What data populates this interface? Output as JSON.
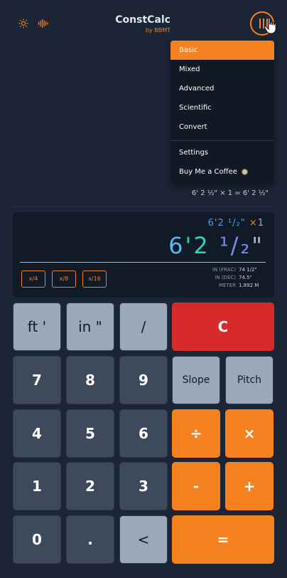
{
  "header": {
    "title": "ConstCalc",
    "subtitle": "by BBMT",
    "left_icons": [
      "sun-icon",
      "sound-wave-icon"
    ],
    "menu_icon": "menu-bars-icon",
    "accent_color": "#f5811f"
  },
  "menu": {
    "items": [
      "Basic",
      "Mixed",
      "Advanced",
      "Scientific",
      "Convert"
    ],
    "active": "Basic",
    "extra_items": [
      "Settings",
      "Buy Me a Coffee"
    ]
  },
  "history": {
    "line": "6' 2 ½\" × 1 = 6' 2 ½\""
  },
  "display": {
    "expr_value": "6'2 ¹/₂\"",
    "expr_op": "×",
    "expr_num": "1",
    "result_ft": "6",
    "result_ft_mark": "'",
    "result_in": "2",
    "result_frac": "¹/₂",
    "result_in_mark": "\"",
    "fraction_buttons": [
      "x/4",
      "x/8",
      "x/16"
    ],
    "conversions": [
      {
        "label": "IN (FRAC)",
        "value": "74 1/2\""
      },
      {
        "label": "IN (DEC)",
        "value": "74.5\""
      },
      {
        "label": "METER",
        "value": "1.892 M"
      }
    ]
  },
  "keypad": {
    "ft": "ft '",
    "in": "in \"",
    "slash": "/",
    "clear": "C",
    "n7": "7",
    "n8": "8",
    "n9": "9",
    "slope": "Slope",
    "pitch": "Pitch",
    "n4": "4",
    "n5": "5",
    "n6": "6",
    "divide": "÷",
    "multiply": "×",
    "n1": "1",
    "n2": "2",
    "n3": "3",
    "minus": "-",
    "plus": "+",
    "n0": "0",
    "dot": ".",
    "back": "<",
    "equals": "="
  }
}
